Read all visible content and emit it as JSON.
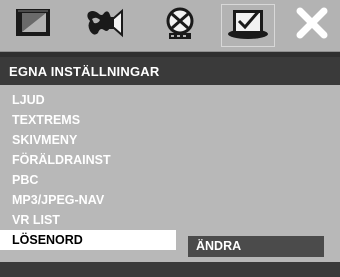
{
  "icons": [
    {
      "name": "display-icon"
    },
    {
      "name": "audio-icon"
    },
    {
      "name": "video-icon"
    },
    {
      "name": "preferences-icon",
      "selected": true
    },
    {
      "name": "close-icon"
    }
  ],
  "header": {
    "title": "EGNA INSTÄLLNINGAR"
  },
  "menu": {
    "items": [
      {
        "label": "LJUD"
      },
      {
        "label": "TEXTREMS"
      },
      {
        "label": "SKIVMENY"
      },
      {
        "label": "FÖRÄLDRAINST"
      },
      {
        "label": "PBC"
      },
      {
        "label": "MP3/JPEG-NAV"
      },
      {
        "label": "VR LIST"
      },
      {
        "label": "LÖSENORD",
        "active": true
      }
    ]
  },
  "submenu": {
    "option": "ÄNDRA"
  },
  "colors": {
    "icon_bar": "#b3b3b3",
    "title_bar": "#3a3a3a",
    "menu_bg": "#b8b8b8",
    "highlight": "#ffffff",
    "submenu_bg": "#4b4b4b"
  }
}
